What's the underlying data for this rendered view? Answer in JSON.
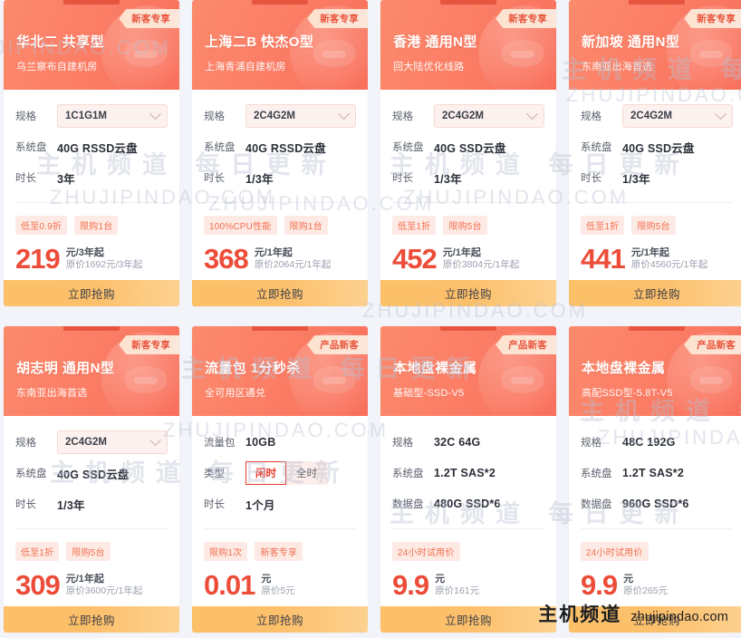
{
  "page": {
    "background_color": "#f2f4f9",
    "watermark_cn": "主机频道 每日更新",
    "watermark_en": "ZHUJIPINDAO.COM",
    "brand_cn": "主机频道",
    "brand_en": "zhujipindao.com",
    "accent_color": "#ec4c38",
    "header_gradient_from": "#fb8a6d",
    "header_gradient_to": "#f9705c",
    "button_gradient_from": "#fcc069",
    "button_gradient_to": "#fdd190"
  },
  "cards": [
    {
      "badge": "新客专享",
      "title": "华北二 共享型",
      "subtitle": "乌兰察布自建机房",
      "rows": [
        {
          "label": "规格",
          "value": "1C1G1M",
          "kind": "select"
        },
        {
          "label": "系统盘",
          "value": "40G RSSD云盘",
          "kind": "text"
        },
        {
          "label": "时长",
          "value": "3年",
          "kind": "text"
        }
      ],
      "tags": [
        "低至0.9折",
        "限购1台"
      ],
      "price": "219",
      "price_unit": "元/3年起",
      "price_original": "原价1692元/3年起",
      "button": "立即抢购"
    },
    {
      "badge": "新客专享",
      "title": "上海二B 快杰O型",
      "subtitle": "上海青浦自建机房",
      "rows": [
        {
          "label": "规格",
          "value": "2C4G2M",
          "kind": "select"
        },
        {
          "label": "系统盘",
          "value": "40G RSSD云盘",
          "kind": "text"
        },
        {
          "label": "时长",
          "value": "1/3年",
          "kind": "text"
        }
      ],
      "tags": [
        "100%CPU性能",
        "限购1台"
      ],
      "price": "368",
      "price_unit": "元/1年起",
      "price_original": "原价2064元/1年起",
      "button": "立即抢购"
    },
    {
      "badge": "新客专享",
      "title": "香港 通用N型",
      "subtitle": "回大陆优化线路",
      "rows": [
        {
          "label": "规格",
          "value": "2C4G2M",
          "kind": "select"
        },
        {
          "label": "系统盘",
          "value": "40G SSD云盘",
          "kind": "text"
        },
        {
          "label": "时长",
          "value": "1/3年",
          "kind": "text"
        }
      ],
      "tags": [
        "低至1折",
        "限购5台"
      ],
      "price": "452",
      "price_unit": "元/1年起",
      "price_original": "原价3804元/1年起",
      "button": "立即抢购"
    },
    {
      "badge": "新客专享",
      "title": "新加坡 通用N型",
      "subtitle": "东南亚出海首选",
      "rows": [
        {
          "label": "规格",
          "value": "2C4G2M",
          "kind": "select"
        },
        {
          "label": "系统盘",
          "value": "40G SSD云盘",
          "kind": "text"
        },
        {
          "label": "时长",
          "value": "1/3年",
          "kind": "text"
        }
      ],
      "tags": [
        "低至1折",
        "限购5台"
      ],
      "price": "441",
      "price_unit": "元/1年起",
      "price_original": "原价4560元/1年起",
      "button": "立即抢购"
    },
    {
      "badge": "新客专享",
      "title": "胡志明 通用N型",
      "subtitle": "东南亚出海首选",
      "rows": [
        {
          "label": "规格",
          "value": "2C4G2M",
          "kind": "select"
        },
        {
          "label": "系统盘",
          "value": "40G SSD云盘",
          "kind": "text"
        },
        {
          "label": "时长",
          "value": "1/3年",
          "kind": "text"
        }
      ],
      "tags": [
        "低至1折",
        "限购5台"
      ],
      "price": "309",
      "price_unit": "元/1年起",
      "price_original": "原价3600元/1年起",
      "button": "立即抢购"
    },
    {
      "badge": "产品新客",
      "title": "流量包 1分秒杀",
      "subtitle": "全可用区通兑",
      "rows": [
        {
          "label": "流量包",
          "value": "10GB",
          "kind": "text"
        },
        {
          "label": "类型",
          "kind": "segment",
          "options": [
            "闲时",
            "全时"
          ],
          "selected": "闲时"
        },
        {
          "label": "时长",
          "value": "1个月",
          "kind": "text"
        }
      ],
      "tags": [
        "限购1次",
        "新客专享"
      ],
      "price": "0.01",
      "price_unit": "元",
      "price_original": "原价5元",
      "button": "立即抢购"
    },
    {
      "badge": "产品新客",
      "title": "本地盘裸金属",
      "subtitle": "基础型-SSD-V5",
      "rows": [
        {
          "label": "规格",
          "value": "32C 64G",
          "kind": "text"
        },
        {
          "label": "系统盘",
          "value": "1.2T SAS*2",
          "kind": "text"
        },
        {
          "label": "数据盘",
          "value": "480G SSD*6",
          "kind": "text"
        }
      ],
      "tags": [
        "24小时试用价"
      ],
      "price": "9.9",
      "price_unit": "元",
      "price_original": "原价161元",
      "button": "立即抢购"
    },
    {
      "badge": "产品新客",
      "title": "本地盘裸金属",
      "subtitle": "高配SSD型-5.8T-V5",
      "rows": [
        {
          "label": "规格",
          "value": "48C 192G",
          "kind": "text"
        },
        {
          "label": "系统盘",
          "value": "1.2T SAS*2",
          "kind": "text"
        },
        {
          "label": "数据盘",
          "value": "960G SSD*6",
          "kind": "text"
        }
      ],
      "tags": [
        "24小时试用价"
      ],
      "price": "9.9",
      "price_unit": "元",
      "price_original": "原价265元",
      "button": "立即抢购"
    }
  ]
}
